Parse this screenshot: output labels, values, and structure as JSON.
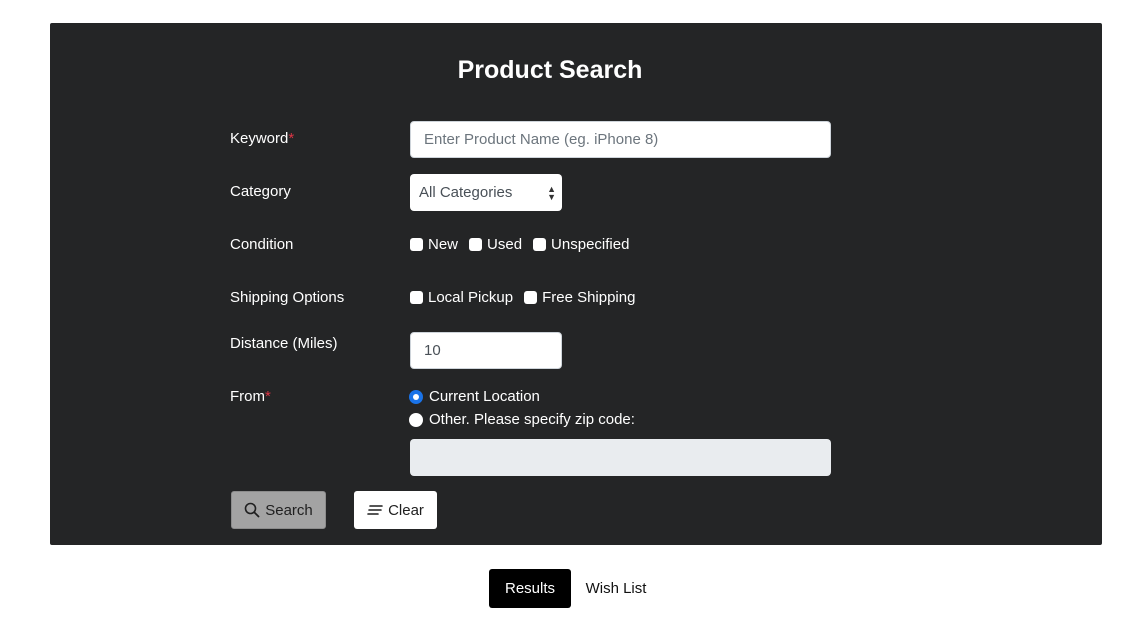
{
  "form": {
    "title": "Product Search",
    "keyword": {
      "label": "Keyword",
      "required_mark": "*",
      "placeholder": "Enter Product Name (eg. iPhone 8)",
      "value": ""
    },
    "category": {
      "label": "Category",
      "selected": "All Categories"
    },
    "condition": {
      "label": "Condition",
      "options": [
        {
          "label": "New",
          "checked": false
        },
        {
          "label": "Used",
          "checked": false
        },
        {
          "label": "Unspecified",
          "checked": false
        }
      ]
    },
    "shipping": {
      "label": "Shipping Options",
      "options": [
        {
          "label": "Local Pickup",
          "checked": false
        },
        {
          "label": "Free Shipping",
          "checked": false
        }
      ]
    },
    "distance": {
      "label": "Distance (Miles)",
      "value": "10"
    },
    "from": {
      "label": "From",
      "required_mark": "*",
      "options": [
        {
          "label": "Current Location",
          "selected": true
        },
        {
          "label": "Other. Please specify zip code:",
          "selected": false
        }
      ],
      "zip_value": ""
    },
    "buttons": {
      "search_label": "Search",
      "search_icon": "search-icon",
      "clear_label": "Clear",
      "clear_icon": "clear-lines-icon"
    }
  },
  "tabs": [
    {
      "label": "Results",
      "active": true
    },
    {
      "label": "Wish List",
      "active": false
    }
  ],
  "colors": {
    "panel_bg": "#242526",
    "required": "#dc3545",
    "radio_selected": "#1a73e8",
    "active_tab_bg": "#000000"
  }
}
